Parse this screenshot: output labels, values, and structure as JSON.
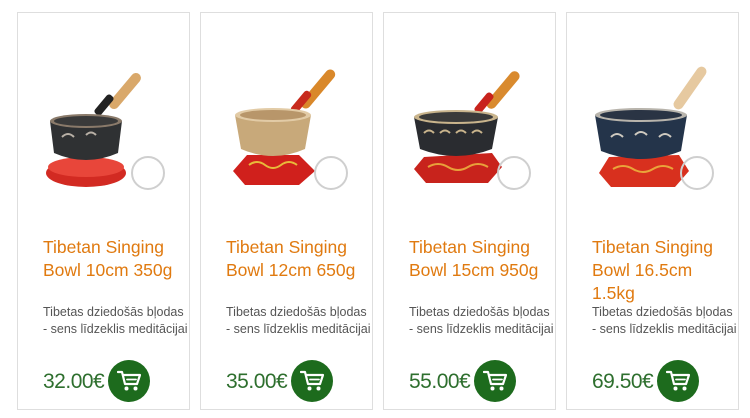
{
  "products": [
    {
      "title": "Tibetan Singing Bowl 10cm 350g",
      "description": "Tibetas dziedošās bļodas - sens līdzeklis meditācijai",
      "price": "32.00€",
      "icon": "cart-icon",
      "bowl_color": "#2f3133",
      "cushion_color": "#d22a22"
    },
    {
      "title": "Tibetan Singing Bowl 12cm 650g",
      "description": "Tibetas dziedošās bļodas - sens līdzeklis meditācijai",
      "price": "35.00€",
      "icon": "cart-icon",
      "bowl_color": "#c8a97a",
      "cushion_color": "#d0201c"
    },
    {
      "title": "Tibetan Singing Bowl 15cm 950g",
      "description": "Tibetas dziedošās bļodas - sens līdzeklis meditācijai",
      "price": "55.00€",
      "icon": "cart-icon",
      "bowl_color": "#2a2c30",
      "cushion_color": "#c8231c"
    },
    {
      "title": "Tibetan Singing Bowl 16.5cm 1.5kg",
      "description": "Tibetas dziedošās bļodas - sens līdzeklis meditācijai",
      "price": "69.50€",
      "icon": "cart-icon",
      "bowl_color": "#24344a",
      "cushion_color": "#d8301e"
    }
  ],
  "colors": {
    "title": "#e07a10",
    "price": "#2e6f2e",
    "cart_button": "#1d6b1d",
    "card_border": "#dedede"
  }
}
